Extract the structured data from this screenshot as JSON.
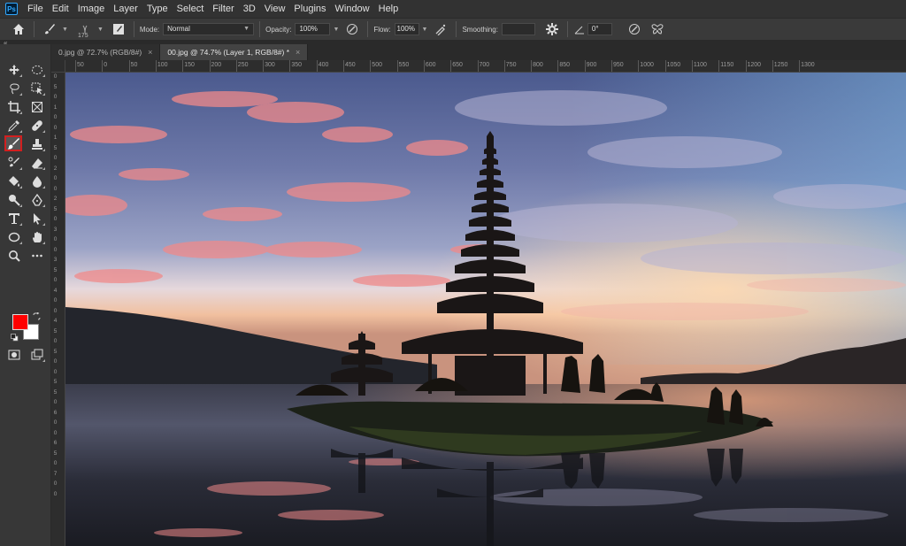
{
  "app": {
    "logo": "Ps"
  },
  "menu": [
    "File",
    "Edit",
    "Image",
    "Layer",
    "Type",
    "Select",
    "Filter",
    "3D",
    "View",
    "Plugins",
    "Window",
    "Help"
  ],
  "options": {
    "brush_size": "175",
    "mode_label": "Mode:",
    "mode_value": "Normal",
    "opacity_label": "Opacity:",
    "opacity_value": "100%",
    "flow_label": "Flow:",
    "flow_value": "100%",
    "smoothing_label": "Smoothing:",
    "smoothing_value": "",
    "angle_value": "0°"
  },
  "tabs": [
    {
      "label": "0.jpg @ 72.7% (RGB/8#)",
      "close": "×",
      "active": false
    },
    {
      "label": "00.jpg @ 74.7% (Layer 1, RGB/8#) *",
      "close": "×",
      "active": true
    }
  ],
  "ruler_top": [
    "50",
    "0",
    "50",
    "100",
    "150",
    "200",
    "250",
    "300",
    "350",
    "400",
    "450",
    "500",
    "550",
    "600",
    "650",
    "700",
    "750",
    "800",
    "850",
    "900",
    "950",
    "1000",
    "1050",
    "1100",
    "1150",
    "1200",
    "1250",
    "1300"
  ],
  "ruler_left": [
    "0",
    "5",
    "0",
    "1",
    "0",
    "0",
    "1",
    "5",
    "0",
    "2",
    "0",
    "0",
    "2",
    "5",
    "0",
    "3",
    "0",
    "0",
    "3",
    "5",
    "0",
    "4",
    "0",
    "0",
    "4",
    "5",
    "0",
    "5",
    "0",
    "0",
    "5",
    "5",
    "0",
    "6",
    "0",
    "0",
    "6",
    "5",
    "0",
    "7",
    "0",
    "0"
  ],
  "colors": {
    "foreground": "#ff0000",
    "background": "#ffffff",
    "selection_highlight": "#d21f1f"
  },
  "tools": [
    "move-icon",
    "marquee-icon",
    "lasso-icon",
    "object-select-icon",
    "crop-icon",
    "frame-icon",
    "eyedropper-icon",
    "healing-brush-icon",
    "brush-icon",
    "stamp-icon",
    "history-brush-icon",
    "eraser-icon",
    "paint-bucket-icon",
    "blur-icon",
    "dodge-icon",
    "pen-icon",
    "type-icon",
    "path-select-icon",
    "ellipse-icon",
    "hand-icon",
    "zoom-icon",
    "more-icon"
  ]
}
